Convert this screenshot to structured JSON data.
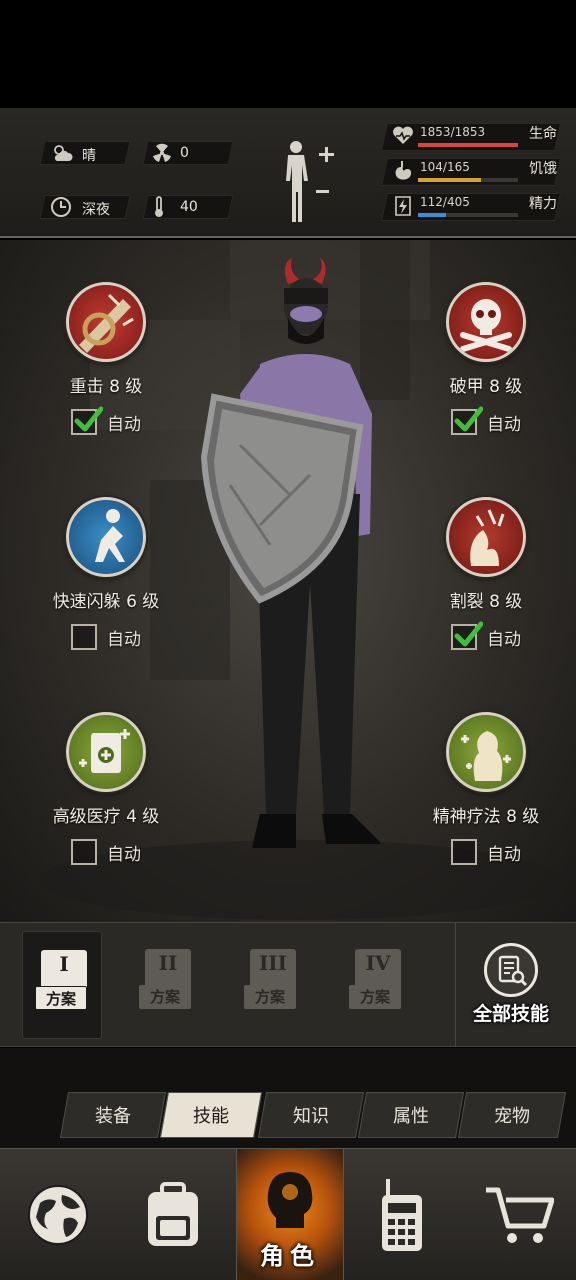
{
  "status": {
    "weather": {
      "icon": "cloud-sun-icon",
      "text": "晴"
    },
    "radiation": {
      "icon": "radiation-icon",
      "text": "0"
    },
    "time": {
      "icon": "clock-icon",
      "text": "深夜"
    },
    "temperature": {
      "icon": "thermometer-icon",
      "text": "40"
    },
    "body_icon": "body-silhouette-icon",
    "stats": [
      {
        "icon": "heart-icon",
        "value": "1853/1853",
        "label": "生命",
        "fraction": 1.0,
        "color": "#d9473c"
      },
      {
        "icon": "stomach-icon",
        "value": "104/165",
        "label": "饥饿",
        "fraction": 0.63,
        "color": "#d6a231"
      },
      {
        "icon": "energy-icon",
        "value": "112/405",
        "label": "精力",
        "fraction": 0.28,
        "color": "#3e8ed6"
      }
    ]
  },
  "skills": [
    {
      "name": "重击 8 级",
      "auto_label": "自动",
      "auto": true,
      "icon": "heavy-strike-icon"
    },
    {
      "name": "破甲 8 级",
      "auto_label": "自动",
      "auto": true,
      "icon": "skull-crossbones-icon"
    },
    {
      "name": "快速闪躲 6 级",
      "auto_label": "自动",
      "auto": false,
      "icon": "dodge-icon"
    },
    {
      "name": "割裂 8 级",
      "auto_label": "自动",
      "auto": true,
      "icon": "lacerate-icon"
    },
    {
      "name": "高级医疗 4 级",
      "auto_label": "自动",
      "auto": false,
      "icon": "medkit-icon"
    },
    {
      "name": "精神疗法 8 级",
      "auto_label": "自动",
      "auto": false,
      "icon": "mind-therapy-icon"
    }
  ],
  "plans": [
    {
      "roman": "I",
      "label": "方案",
      "active": true
    },
    {
      "roman": "II",
      "label": "方案",
      "active": false
    },
    {
      "roman": "III",
      "label": "方案",
      "active": false
    },
    {
      "roman": "IV",
      "label": "方案",
      "active": false
    }
  ],
  "all_skills_label": "全部技能",
  "tabs": [
    "装备",
    "技能",
    "知识",
    "属性",
    "宠物"
  ],
  "active_tab": "技能",
  "nav": {
    "items": [
      "globe-icon",
      "backpack-icon",
      "character-icon",
      "walkie-talkie-icon",
      "shopping-cart-icon"
    ],
    "active_label": "角色"
  },
  "colors": {
    "active_nav": "#f08a1a",
    "checkmark": "#3fbf3a"
  }
}
